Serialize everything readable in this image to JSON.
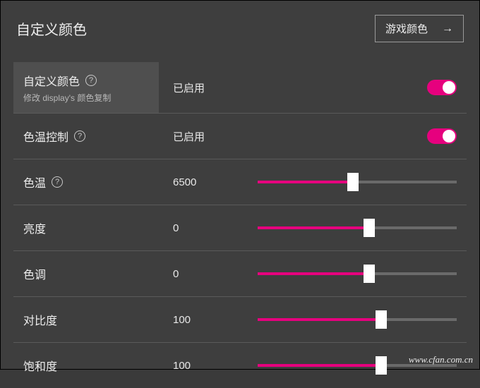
{
  "header": {
    "title": "自定义颜色",
    "game_color_label": "游戏颜色"
  },
  "rows": {
    "custom_color": {
      "label": "自定义颜色",
      "sub": "修改 display's 颜色复制",
      "status": "已启用"
    },
    "temp_control": {
      "label": "色温控制",
      "status": "已启用"
    },
    "temperature": {
      "label": "色温",
      "value": "6500",
      "fill_pct": 48
    },
    "brightness": {
      "label": "亮度",
      "value": "0",
      "fill_pct": 56
    },
    "hue": {
      "label": "色调",
      "value": "0",
      "fill_pct": 56
    },
    "contrast": {
      "label": "对比度",
      "value": "100",
      "fill_pct": 62
    },
    "saturation": {
      "label": "饱和度",
      "value": "100",
      "fill_pct": 62
    }
  },
  "watermark": "www.cfan.com.cn"
}
